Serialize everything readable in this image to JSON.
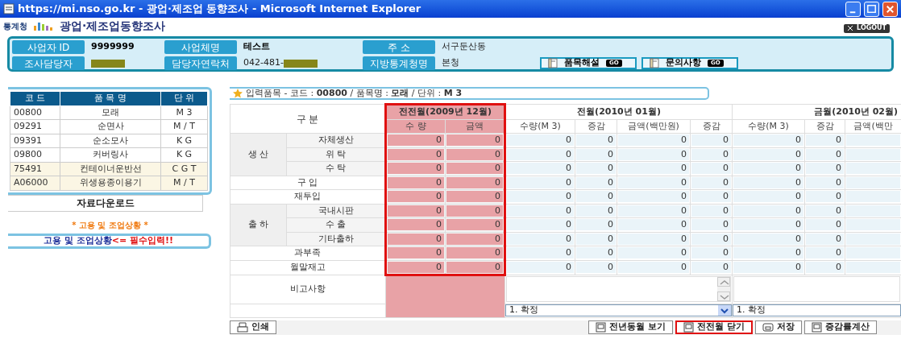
{
  "window": {
    "title": "https://mi.nso.go.kr - 광업·제조업 동향조사 - Microsoft Internet Explorer"
  },
  "header": {
    "agency": "통계청",
    "title": "광업·제조업동향조사",
    "logout": "LOGOUT"
  },
  "info": {
    "fields": [
      {
        "label": "사업자 ID",
        "value": "9999999",
        "bold": true,
        "redacted": false
      },
      {
        "label": "사업체명",
        "value": "테스트",
        "bold": true,
        "redacted": false
      },
      {
        "label": "주 소",
        "value": "서구둔산동",
        "bold": false,
        "redacted": false
      },
      {
        "label": "조사담당자",
        "redacted": true
      },
      {
        "label": "담당자연락처",
        "value": "042-481-",
        "bold": false,
        "redacted": true
      },
      {
        "label": "지방통계청명",
        "value": "본청",
        "bold": false,
        "redacted": false
      }
    ],
    "links": [
      {
        "label": "품목해설",
        "go": "GO"
      },
      {
        "label": "문의사항",
        "go": "GO"
      }
    ]
  },
  "items": {
    "columns": [
      "코 드",
      "품 목 명",
      "단 위"
    ],
    "rows": [
      {
        "code": "00800",
        "name": "모래",
        "unit": "M 3",
        "highlighted": false
      },
      {
        "code": "09291",
        "name": "순면사",
        "unit": "M / T",
        "highlighted": false
      },
      {
        "code": "09391",
        "name": "순소모사",
        "unit": "K G",
        "highlighted": false
      },
      {
        "code": "09800",
        "name": "커버링사",
        "unit": "K G",
        "highlighted": false
      },
      {
        "code": "75491",
        "name": "컨테이너운반선",
        "unit": "C G T",
        "highlighted": true
      },
      {
        "code": "A06000",
        "name": "위생용종이용기",
        "unit": "M / T",
        "highlighted": true
      }
    ],
    "download": "자료다운로드",
    "employment_note": "* 고용 및 조업상황 *",
    "employment_link": "고용 및 조업상황",
    "required_note": "<= 필수입력!!"
  },
  "entry": {
    "heading": "입력품목 - 코드 : **00800** / 품목명 : **모래** / 단위 : **M 3**",
    "row_header": "구 분",
    "periods": [
      {
        "title": "전전월(2009년 12월)",
        "highlighted": true,
        "columns": [
          "수 량",
          "금액"
        ]
      },
      {
        "title": "전월(2010년 01월)",
        "highlighted": false,
        "columns": [
          "수량(M 3)",
          "증감",
          "금액(백만원)",
          "증감"
        ]
      },
      {
        "title": "금월(2010년 02월)",
        "highlighted": false,
        "columns": [
          "수량(M 3)",
          "증감",
          "금액(백만"
        ]
      }
    ],
    "rows": [
      {
        "label": "생 산",
        "children": [
          {
            "label": "자체생산",
            "values": [
              "0",
              "0",
              "0",
              "0",
              "0",
              "0",
              "0",
              "0"
            ]
          },
          {
            "label": "위 탁",
            "values": [
              "0",
              "0",
              "0",
              "0",
              "0",
              "0",
              "0",
              "0"
            ]
          },
          {
            "label": "수 탁",
            "values": [
              "0",
              "0",
              "0",
              "0",
              "0",
              "0",
              "0",
              "0"
            ]
          }
        ]
      },
      {
        "label": "구 입",
        "values": [
          "0",
          "0",
          "0",
          "0",
          "0",
          "0",
          "0",
          "0"
        ]
      },
      {
        "label": "재투입",
        "values": [
          "0",
          "0",
          "0",
          "0",
          "0",
          "0",
          "0",
          "0"
        ]
      },
      {
        "label": "출 하",
        "children": [
          {
            "label": "국내시판",
            "values": [
              "0",
              "0",
              "0",
              "0",
              "0",
              "0",
              "0",
              "0"
            ]
          },
          {
            "label": "수 출",
            "values": [
              "0",
              "0",
              "0",
              "0",
              "0",
              "0",
              "0",
              "0"
            ]
          },
          {
            "label": "기타출하",
            "values": [
              "0",
              "0",
              "0",
              "0",
              "0",
              "0",
              "0",
              "0"
            ]
          }
        ]
      },
      {
        "label": "과부족",
        "values": [
          "0",
          "0",
          "0",
          "0",
          "0",
          "0",
          "0",
          "0"
        ]
      },
      {
        "label": "월말재고",
        "values": [
          "0",
          "0",
          "0",
          "0",
          "0",
          "0",
          "0",
          "0"
        ]
      }
    ],
    "remarks_label": "비고사항",
    "status": [
      "1. 확정",
      "1. 확정"
    ]
  },
  "buttons": [
    {
      "label": "인쇄",
      "kind": "print",
      "highlighted": false
    },
    {
      "label": "전년동월 보기",
      "kind": "view",
      "highlighted": false
    },
    {
      "label": "전전월 닫기",
      "kind": "view",
      "highlighted": true
    },
    {
      "label": "저장",
      "kind": "save",
      "highlighted": false
    },
    {
      "label": "증감률계산",
      "kind": "view",
      "highlighted": false
    }
  ]
}
